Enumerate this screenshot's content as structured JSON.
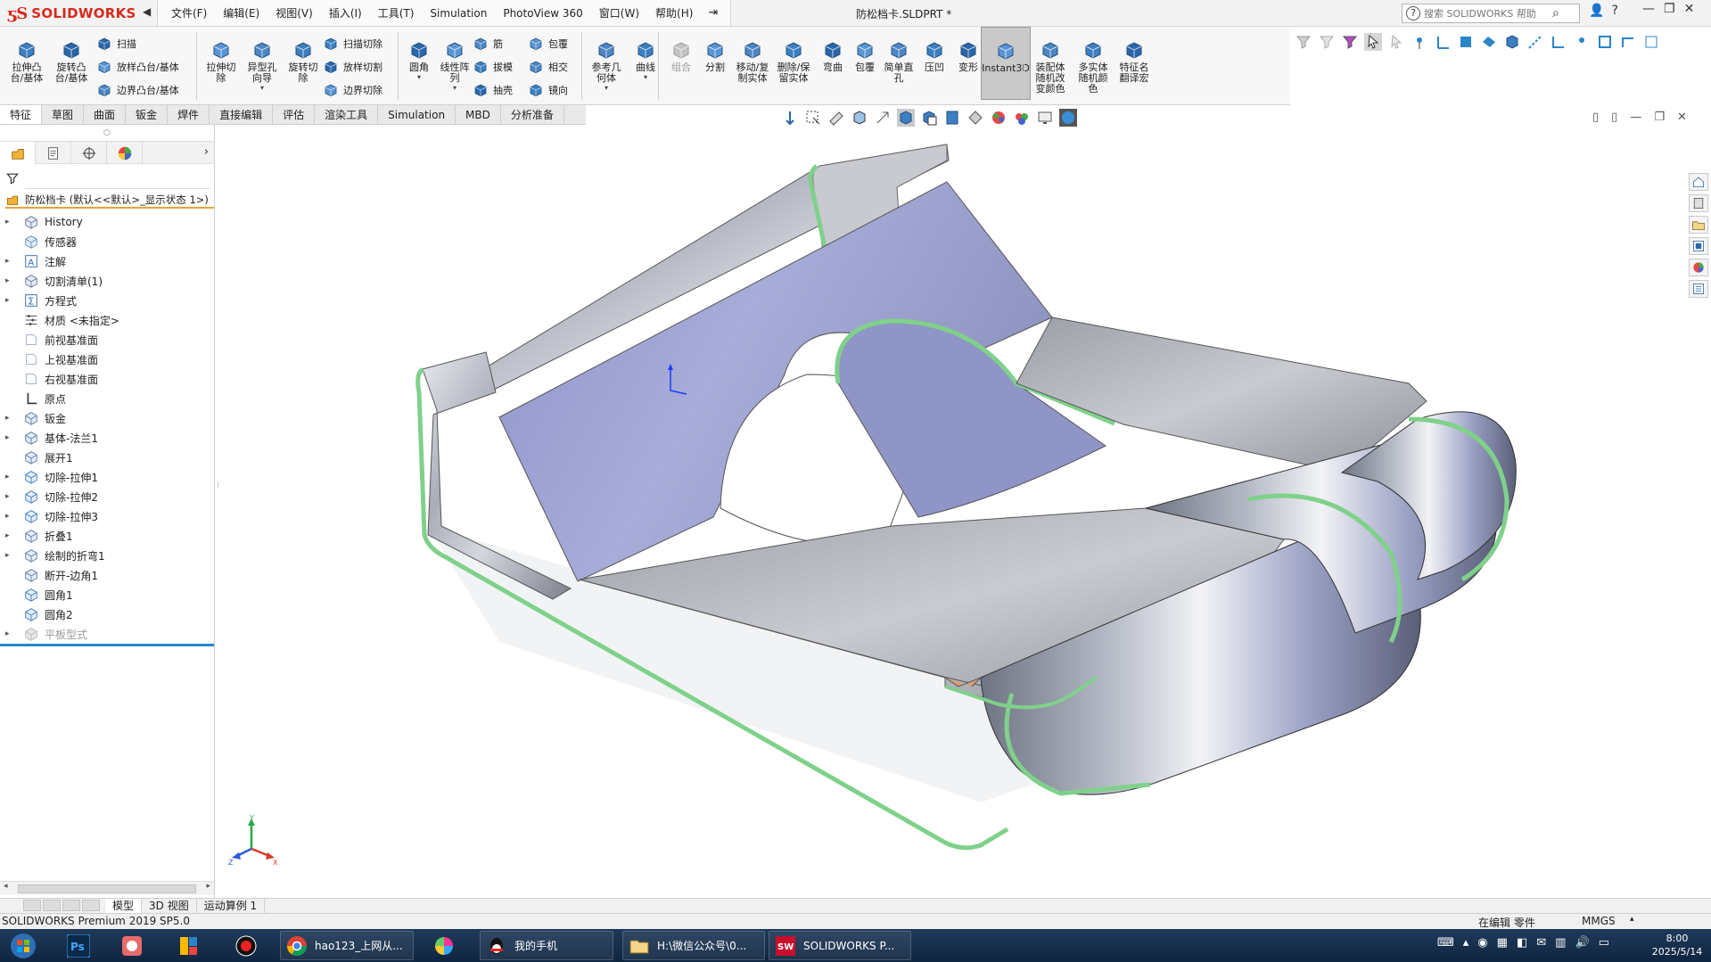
{
  "app": {
    "brand": "SOLIDWORKS",
    "document_title": "防松档卡.SLDPRT *",
    "menus": [
      "文件(F)",
      "编辑(E)",
      "视图(V)",
      "插入(I)",
      "工具(T)",
      "Simulation",
      "PhotoView 360",
      "窗口(W)",
      "帮助(H)"
    ],
    "search_placeholder": "搜索 SOLIDWORKS 帮助"
  },
  "command_manager": {
    "big_buttons": [
      {
        "label": "拉伸凸\n台/基体",
        "icon": "extruded-boss-icon"
      },
      {
        "label": "旋转凸\n台/基体",
        "icon": "revolved-boss-icon"
      },
      {
        "label": "拉伸切\n除",
        "icon": "extruded-cut-icon"
      },
      {
        "label": "异型孔\n向导",
        "icon": "hole-wizard-icon"
      },
      {
        "label": "旋转切\n除",
        "icon": "revolved-cut-icon"
      },
      {
        "label": "圆角",
        "icon": "fillet-icon"
      },
      {
        "label": "线性阵\n列",
        "icon": "linear-pattern-icon"
      },
      {
        "label": "参考几\n何体",
        "icon": "reference-geometry-icon"
      },
      {
        "label": "曲线",
        "icon": "curves-icon"
      },
      {
        "label": "组合",
        "icon": "combine-icon"
      },
      {
        "label": "分割",
        "icon": "split-icon"
      },
      {
        "label": "移动/复\n制实体",
        "icon": "move-copy-body-icon"
      },
      {
        "label": "删除/保\n留实体",
        "icon": "delete-keep-body-icon"
      },
      {
        "label": "弯曲",
        "icon": "flex-icon"
      },
      {
        "label": "包覆",
        "icon": "wrap-icon"
      },
      {
        "label": "简单直\n孔",
        "icon": "simple-hole-icon"
      },
      {
        "label": "压凹",
        "icon": "indent-icon"
      },
      {
        "label": "变形",
        "icon": "deform-icon"
      },
      {
        "label": "Instant3D",
        "icon": "instant3d-icon"
      },
      {
        "label": "装配体\n随机改\n变颜色",
        "icon": "assembly-random-color-icon"
      },
      {
        "label": "多实体\n随机颜\n色",
        "icon": "multibody-random-color-icon"
      },
      {
        "label": "特征名\n翻译宏",
        "icon": "feature-name-macro-icon"
      }
    ],
    "small_buttons": [
      {
        "label": "扫描",
        "icon": "sweep-icon"
      },
      {
        "label": "放样凸台/基体",
        "icon": "loft-icon"
      },
      {
        "label": "边界凸台/基体",
        "icon": "boundary-boss-icon"
      },
      {
        "label": "扫描切除",
        "icon": "swept-cut-icon"
      },
      {
        "label": "放样切割",
        "icon": "lofted-cut-icon"
      },
      {
        "label": "边界切除",
        "icon": "boundary-cut-icon"
      },
      {
        "label": "筋",
        "icon": "rib-icon"
      },
      {
        "label": "拔模",
        "icon": "draft-icon"
      },
      {
        "label": "抽壳",
        "icon": "shell-icon"
      },
      {
        "label": "包覆",
        "icon": "wrap-small-icon"
      },
      {
        "label": "相交",
        "icon": "intersect-icon"
      },
      {
        "label": "镜向",
        "icon": "mirror-icon"
      }
    ]
  },
  "cm_tabs": [
    "特征",
    "草图",
    "曲面",
    "钣金",
    "焊件",
    "直接编辑",
    "评估",
    "渲染工具",
    "Simulation",
    "MBD",
    "分析准备"
  ],
  "active_cm_tab": "特征",
  "feature_manager": {
    "root_label": "防松档卡 (默认<<默认>_显示状态 1>)",
    "nodes": [
      {
        "label": "History",
        "expand": true,
        "icon": "history-icon"
      },
      {
        "label": "传感器",
        "expand": false,
        "icon": "sensors-icon"
      },
      {
        "label": "注解",
        "expand": true,
        "icon": "annotations-icon"
      },
      {
        "label": "切割清单(1)",
        "expand": true,
        "icon": "cut-list-icon"
      },
      {
        "label": "方程式",
        "expand": true,
        "icon": "equations-icon"
      },
      {
        "label": "材质 <未指定>",
        "expand": false,
        "icon": "material-icon"
      },
      {
        "label": "前视基准面",
        "expand": false,
        "icon": "plane-icon"
      },
      {
        "label": "上视基准面",
        "expand": false,
        "icon": "plane-icon"
      },
      {
        "label": "右视基准面",
        "expand": false,
        "icon": "plane-icon"
      },
      {
        "label": "原点",
        "expand": false,
        "icon": "origin-icon"
      },
      {
        "label": "钣金",
        "expand": true,
        "icon": "sheet-metal-icon"
      },
      {
        "label": "基体-法兰1",
        "expand": true,
        "icon": "base-flange-icon"
      },
      {
        "label": "展开1",
        "expand": false,
        "icon": "unfold-icon"
      },
      {
        "label": "切除-拉伸1",
        "expand": true,
        "icon": "cut-extrude-icon"
      },
      {
        "label": "切除-拉伸2",
        "expand": true,
        "icon": "cut-extrude-icon"
      },
      {
        "label": "切除-拉伸3",
        "expand": true,
        "icon": "cut-extrude-icon"
      },
      {
        "label": "折叠1",
        "expand": true,
        "icon": "fold-icon"
      },
      {
        "label": "绘制的折弯1",
        "expand": true,
        "icon": "sketched-bend-icon"
      },
      {
        "label": "断开-边角1",
        "expand": false,
        "icon": "break-corner-icon"
      },
      {
        "label": "圆角1",
        "expand": false,
        "icon": "fillet-feature-icon"
      },
      {
        "label": "圆角2",
        "expand": false,
        "icon": "fillet-feature-icon"
      },
      {
        "label": "平板型式",
        "expand": true,
        "icon": "flat-pattern-icon",
        "greyed": true
      }
    ]
  },
  "model_tabs": [
    "模型",
    "3D 视图",
    "运动算例 1"
  ],
  "active_model_tab": "模型",
  "status": {
    "left": "SOLIDWORKS Premium 2019 SP5.0",
    "editing": "在编辑 零件",
    "units": "MMGS"
  },
  "taskbar": {
    "items": [
      {
        "label": "hao123_上网从...",
        "icon": "chrome-icon"
      },
      {
        "label": "我的手机",
        "icon": "qq-icon"
      },
      {
        "label": "H:\\微信公众号\\0...",
        "icon": "folder-icon"
      },
      {
        "label": "SOLIDWORKS P...",
        "icon": "solidworks-icon"
      }
    ],
    "time": "8:00",
    "date": "2025/5/14"
  },
  "colors": {
    "brand_red": "#d52b1e",
    "accent_blue": "#2a86c8",
    "taskbar": "#16304e",
    "part_edge": "#7fd18a"
  }
}
